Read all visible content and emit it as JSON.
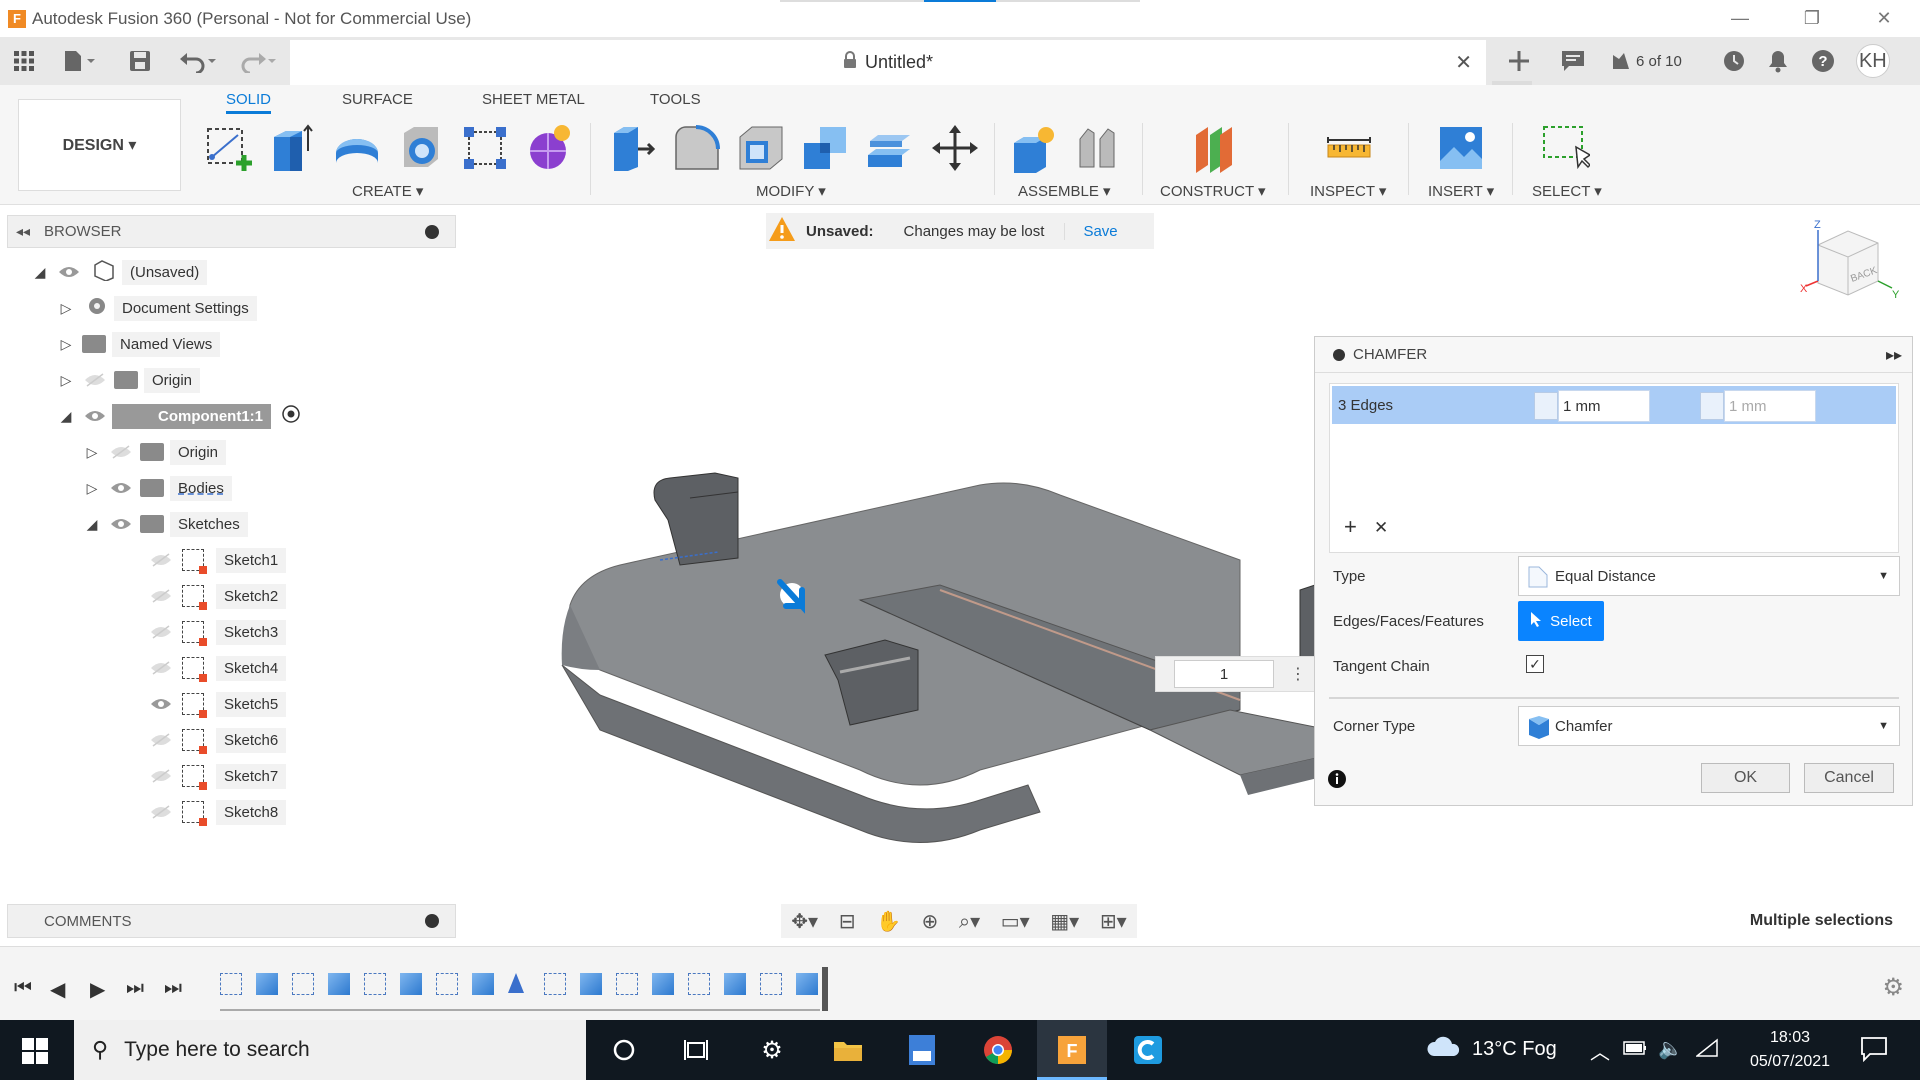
{
  "window": {
    "title": "Autodesk Fusion 360 (Personal - Not for Commercial Use)",
    "app_logo": "F",
    "minimize": "—",
    "restore": "❐",
    "close": "✕"
  },
  "document": {
    "tab_title": "Untitled*",
    "tab_close": "✕",
    "jobs": "6 of 10",
    "user_initials": "KH"
  },
  "ribbon": {
    "workspace": "DESIGN ▾",
    "tabs": [
      "SOLID",
      "SURFACE",
      "SHEET METAL",
      "TOOLS"
    ],
    "groups": [
      "CREATE ▾",
      "MODIFY ▾",
      "ASSEMBLE ▾",
      "CONSTRUCT ▾",
      "INSPECT ▾",
      "INSERT ▾",
      "SELECT ▾"
    ]
  },
  "browser": {
    "title": "BROWSER",
    "items": [
      {
        "label": "(Unsaved)"
      },
      {
        "label": "Document Settings"
      },
      {
        "label": "Named Views"
      },
      {
        "label": "Origin"
      },
      {
        "label": "Component1:1"
      },
      {
        "label": "Origin"
      },
      {
        "label": "Bodies"
      },
      {
        "label": "Sketches"
      },
      {
        "label": "Sketch1"
      },
      {
        "label": "Sketch2"
      },
      {
        "label": "Sketch3"
      },
      {
        "label": "Sketch4"
      },
      {
        "label": "Sketch5"
      },
      {
        "label": "Sketch6"
      },
      {
        "label": "Sketch7"
      },
      {
        "label": "Sketch8"
      }
    ]
  },
  "unsaved_bar": {
    "status": "Unsaved:",
    "message": "Changes may be lost",
    "save": "Save"
  },
  "viewcube": {
    "face": "BACK",
    "axis_z": "Z",
    "axis_x": "X",
    "axis_y": "Y"
  },
  "chamfer": {
    "title": "CHAMFER",
    "edges": "3 Edges",
    "distance1": "1 mm",
    "distance2": "1 mm",
    "type_label": "Type",
    "type_value": "Equal Distance",
    "edges_label": "Edges/Faces/Features",
    "select_label": "Select",
    "tangent_label": "Tangent Chain",
    "tangent_checked": "✓",
    "corner_label": "Corner Type",
    "corner_value": "Chamfer",
    "ok": "OK",
    "cancel": "Cancel",
    "add": "+",
    "remove": "✕"
  },
  "viewport_input": "1",
  "comments": {
    "title": "COMMENTS"
  },
  "status_text": "Multiple selections",
  "taskbar": {
    "search_placeholder": "Type here to search",
    "weather": "13°C  Fog",
    "time": "18:03",
    "date": "05/07/2021"
  },
  "colors": {
    "accent": "#0a7bd8",
    "select_btn": "#0a84ff",
    "edge_row": "#aaccf6",
    "taskbar": "#101820",
    "warning": "#f59c1a"
  }
}
